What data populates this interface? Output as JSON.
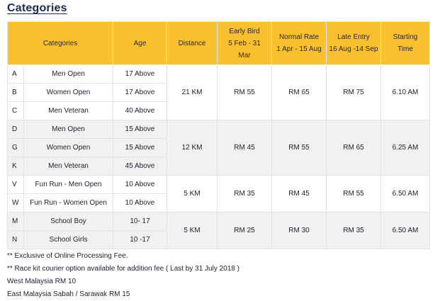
{
  "title": "Categories",
  "headers": {
    "categories": "Categories",
    "age": "Age",
    "distance": "Distance",
    "early_bird_1": "Early Bird",
    "early_bird_2": "5 Feb - 31",
    "early_bird_3": "Mar",
    "normal_1": "Normal Rate",
    "normal_2": "1 Apr - 15 Aug",
    "late_1": "Late Entry",
    "late_2": "16 Aug -14 Sep",
    "start_1": "Starting",
    "start_2": "Time"
  },
  "rows": [
    {
      "code": "A",
      "category": "Men Open",
      "age": "17 Above"
    },
    {
      "code": "B",
      "category": "Women Open",
      "age": "17 Above"
    },
    {
      "code": "C",
      "category": "Men Veteran",
      "age": "40 Above"
    },
    {
      "code": "D",
      "category": "Men Open",
      "age": "15 Above"
    },
    {
      "code": "G",
      "category": "Women Open",
      "age": "15 Above"
    },
    {
      "code": "K",
      "category": "Men Veteran",
      "age": "45 Above"
    },
    {
      "code": "V",
      "category": "Fun Run - Men Open",
      "age": "10 Above"
    },
    {
      "code": "W",
      "category": "Fun Run - Women Open",
      "age": "10 Above"
    },
    {
      "code": "M",
      "category": "School Boy",
      "age": "10- 17"
    },
    {
      "code": "N",
      "category": "School Girls",
      "age": "10 -17"
    }
  ],
  "groups": [
    {
      "distance": "21 KM",
      "early": "RM 55",
      "normal": "RM 65",
      "late": "RM 75",
      "start": "6.10 AM"
    },
    {
      "distance": "12 KM",
      "early": "RM 45",
      "normal": "RM 55",
      "late": "RM 65",
      "start": "6.25 AM"
    },
    {
      "distance": "5 KM",
      "early": "RM 35",
      "normal": "RM 45",
      "late": "RM 55",
      "start": "6.50 AM"
    },
    {
      "distance": "5 KM",
      "early": "RM 25",
      "normal": "RM 30",
      "late": "RM 35",
      "start": "6.50 AM"
    }
  ],
  "notes": [
    "** Exclusive of Online Processing Fee.",
    "** Race kit courier option available for addition fee ( Last by 31 July 2018 )",
    "West Malaysia RM 10",
    "East Malaysia Sabah / Sarawak RM 15"
  ]
}
